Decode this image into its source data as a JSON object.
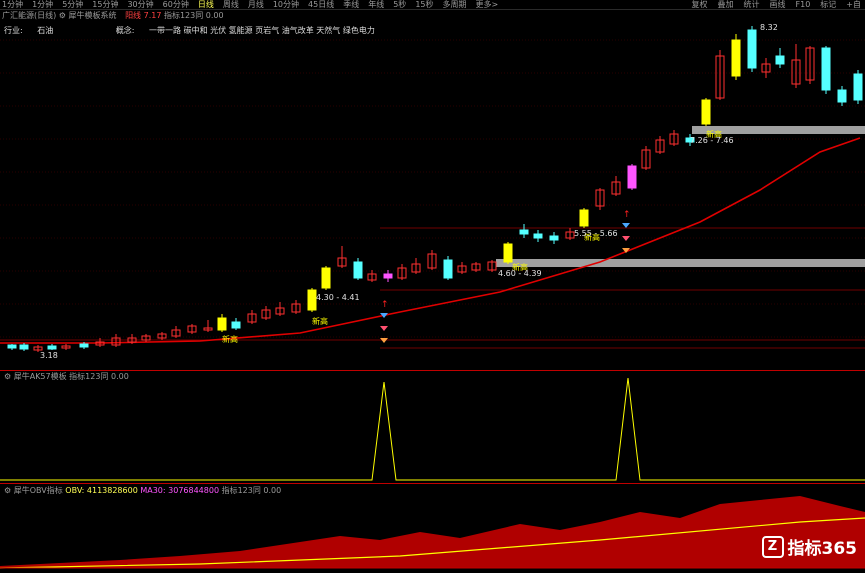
{
  "toolbar": {
    "periods": [
      "1分钟",
      "1分钟",
      "5分钟",
      "15分钟",
      "30分钟",
      "60分钟",
      "日线",
      "周线",
      "月线",
      "10分钟",
      "45日线",
      "季线",
      "年线",
      "5秒",
      "15秒",
      "多周期",
      "更多>"
    ],
    "active_index": 6,
    "right_items": [
      "复权",
      "叠加",
      "统计",
      "画线",
      "F10",
      "标记",
      "+自"
    ]
  },
  "main_title": {
    "stock": "广汇能源(日线)",
    "indicator": "犀牛模板系统",
    "label1": "阳线",
    "value1": "7.17",
    "label2": "指标123同",
    "value2": "0.00"
  },
  "info": {
    "industry_label": "行业:",
    "industry": "石油",
    "concept_label": "概念:",
    "concepts": "一带一路 碳中和 光伏 氢能源 页岩气 油气改革 天然气 绿色电力"
  },
  "annotations": {
    "high_price": "8.32",
    "low_price": "3.18",
    "new_high": "新高",
    "ranges": [
      "4.30 - 4.41",
      "4.60 - 4.39",
      "5.55 - 5.66",
      "7.26 - 7.46"
    ]
  },
  "panel2": {
    "title": "犀牛AK57模板",
    "label": "指标123同",
    "value": "0.00"
  },
  "panel3": {
    "title": "犀牛OBV指标",
    "obv_label": "OBV:",
    "obv_value": "4113828600",
    "ma_label": "MA30:",
    "ma_value": "3076844800",
    "label": "指标123同",
    "value": "0.00"
  },
  "watermark": {
    "text": "指标365",
    "logo_icon": "z-logo-icon"
  },
  "colors": {
    "up": "#ff3030",
    "down": "#55ffff",
    "signal": "#ffff00",
    "ma": "#e00000",
    "obv_fill": "#b00000",
    "zone": "#a0a0a0"
  }
}
